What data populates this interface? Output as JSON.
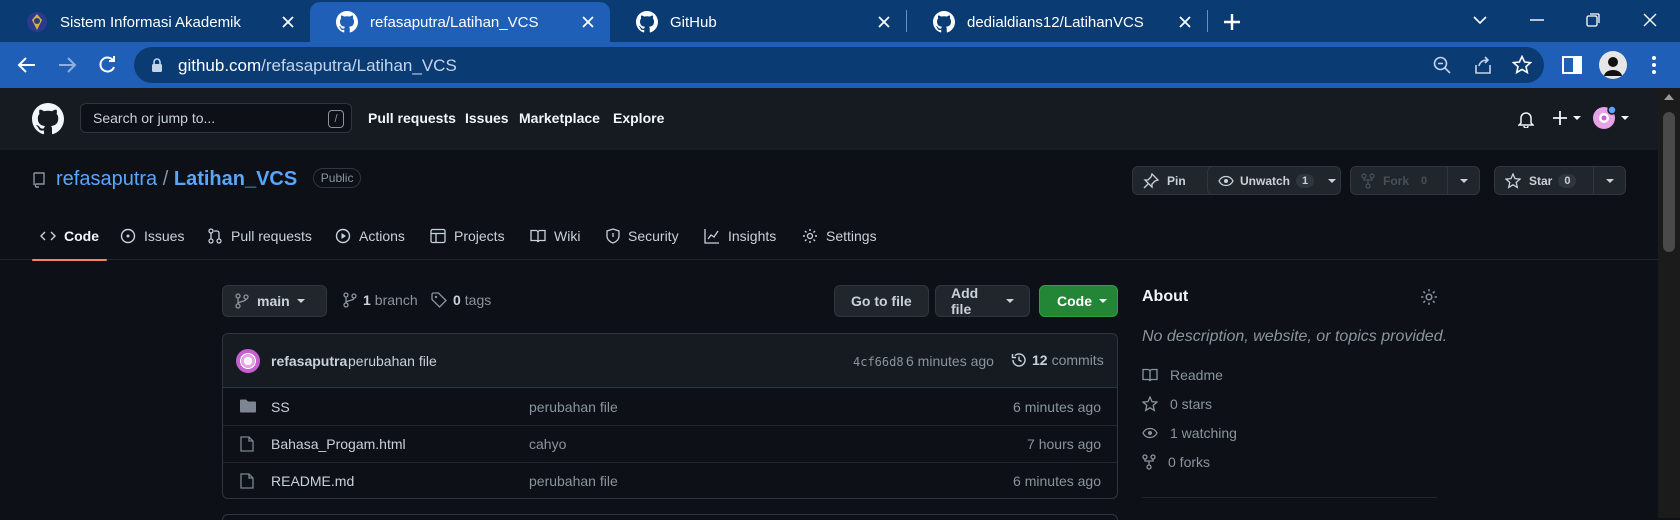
{
  "browser": {
    "tabs": [
      {
        "title": "Sistem Informasi Akademik",
        "active": false
      },
      {
        "title": "refasaputra/Latihan_VCS",
        "active": true
      },
      {
        "title": "GitHub",
        "active": false
      },
      {
        "title": "dedialdians12/LatihanVCS",
        "active": false
      }
    ],
    "address": {
      "host": "github.com",
      "path": "/refasaputra/Latihan_VCS"
    }
  },
  "gh_header": {
    "search_placeholder": "Search or jump to...",
    "search_shortcut": "/",
    "nav": [
      "Pull requests",
      "Issues",
      "Marketplace",
      "Explore"
    ]
  },
  "repo": {
    "owner": "refasaputra",
    "separator": "/",
    "name": "Latihan_VCS",
    "visibility": "Public",
    "actions": {
      "pin": "Pin",
      "unwatch": "Unwatch",
      "watch_count": "1",
      "fork": "Fork",
      "fork_count": "0",
      "star": "Star",
      "star_count": "0"
    },
    "tabs": [
      "Code",
      "Issues",
      "Pull requests",
      "Actions",
      "Projects",
      "Wiki",
      "Security",
      "Insights",
      "Settings"
    ],
    "selected_tab": "Code"
  },
  "file_nav": {
    "branch": "main",
    "branch_count": "1",
    "branch_label": "branch",
    "tag_count": "0",
    "tag_label": "tags",
    "go_to_file": "Go to file",
    "add_file": "Add file",
    "code": "Code"
  },
  "latest_commit": {
    "author": "refasaputra",
    "message": "perubahan file",
    "sha": "4cf66d8",
    "age": "6 minutes ago",
    "commit_count": "12",
    "commit_label": "commits"
  },
  "files": [
    {
      "type": "folder",
      "name": "SS",
      "message": "perubahan file",
      "age": "6 minutes ago"
    },
    {
      "type": "file",
      "name": "Bahasa_Progam.html",
      "message": "cahyo",
      "age": "7 hours ago"
    },
    {
      "type": "file",
      "name": "README.md",
      "message": "perubahan file",
      "age": "6 minutes ago"
    }
  ],
  "about": {
    "heading": "About",
    "description": "No description, website, or topics provided.",
    "readme": "Readme",
    "stars": "0 stars",
    "watching": "1 watching",
    "forks": "0 forks"
  },
  "colors": {
    "tab_strip": "#0b3b73",
    "active_tab": "#1f5fb7",
    "gh_bg": "#0d1117",
    "link": "#58a6ff",
    "green_button": "#238636",
    "selected_underline": "#f78166"
  }
}
